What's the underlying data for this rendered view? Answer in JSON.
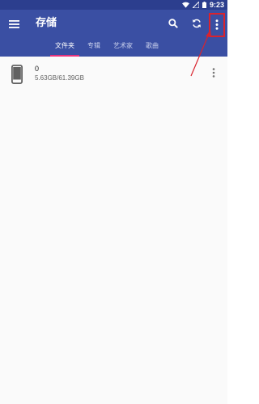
{
  "status_bar": {
    "time": "9:23",
    "icons": [
      "wifi-icon",
      "signal-icon",
      "battery-icon"
    ]
  },
  "app_bar": {
    "title": "存储",
    "icons": [
      "menu-icon",
      "search-icon",
      "refresh-icon",
      "more-vert-icon"
    ],
    "background_color": "#3a4fa3",
    "status_bar_color": "#2c3e8e"
  },
  "tabs": [
    {
      "label": "文件夹",
      "active": true
    },
    {
      "label": "专辑",
      "active": false
    },
    {
      "label": "艺术家",
      "active": false
    },
    {
      "label": "歌曲",
      "active": false
    }
  ],
  "tab_indicator_color": "#e8327d",
  "storage_list": [
    {
      "icon": "phone-icon",
      "title": "0",
      "subtitle": "5.63GB/61.39GB"
    }
  ],
  "annotation": {
    "highlight_color": "#d9232e",
    "target": "more-options-button"
  }
}
